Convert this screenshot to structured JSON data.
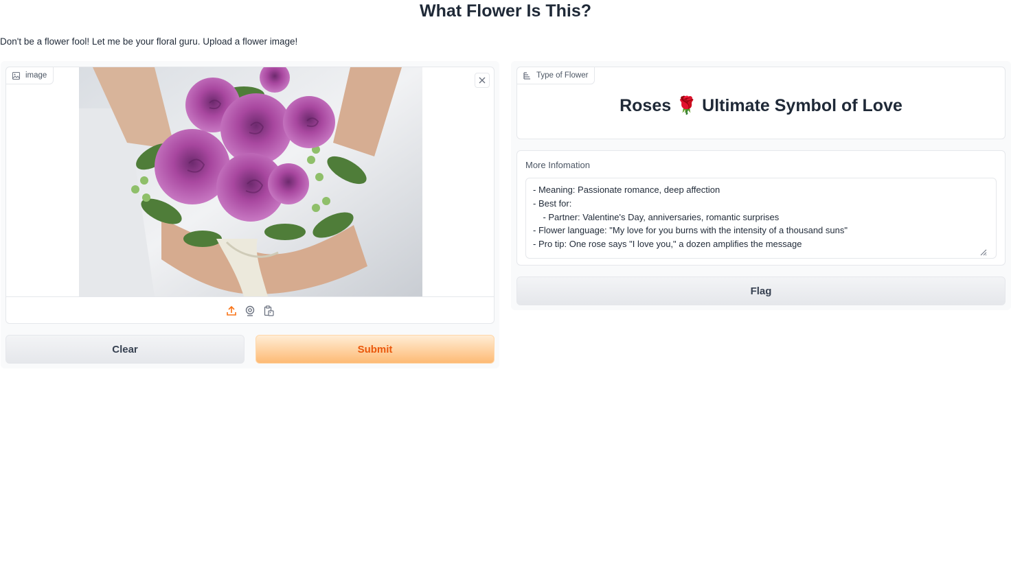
{
  "header": {
    "title": "What Flower Is This?",
    "description": "Don't be a flower fool! Let me be your floral guru. Upload a flower image!"
  },
  "input": {
    "image_label": "image",
    "image_icon": "image-icon",
    "close_icon": "close-icon",
    "toolbar_icons": [
      "upload-icon",
      "webcam-icon",
      "clipboard-icon"
    ],
    "colors": {
      "upload_icon": "#f97316"
    }
  },
  "actions": {
    "clear_label": "Clear",
    "submit_label": "Submit",
    "flag_label": "Flag"
  },
  "output": {
    "label_title": "Type of Flower",
    "label_value": "Roses 🌹 Ultimate Symbol of Love",
    "info_title": "More Infomation",
    "info_text": "- Meaning: Passionate romance, deep affection\n- Best for:\n    - Partner: Valentine's Day, anniversaries, romantic surprises\n- Flower language: \"My love for you burns with the intensity of a thousand suns\"\n- Pro tip: One rose says \"I love you,\" a dozen amplifies the message"
  }
}
